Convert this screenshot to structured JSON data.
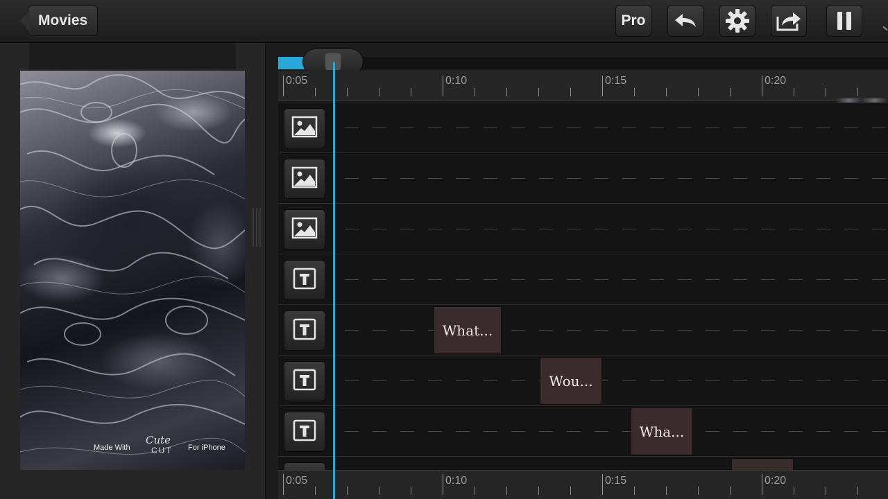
{
  "header": {
    "back_label": "Movies",
    "pro_label": "Pro",
    "icons": [
      "undo-icon",
      "gear-icon",
      "share-icon",
      "pause-icon"
    ]
  },
  "preview": {
    "watermark_left": "Made With",
    "watermark_logo_script": "Cute",
    "watermark_logo_word": "CUT",
    "watermark_right": "For iPhone"
  },
  "timeline": {
    "scrub_progress": 0.05,
    "ruler_labels": [
      "0:05",
      "0:10",
      "0:15",
      "0:20"
    ],
    "tracks": [
      {
        "type": "image",
        "icon": "image-icon"
      },
      {
        "type": "image",
        "icon": "image-icon"
      },
      {
        "type": "image",
        "icon": "image-icon"
      },
      {
        "type": "text",
        "icon": "text-icon"
      },
      {
        "type": "text",
        "icon": "text-icon",
        "clip": "What..."
      },
      {
        "type": "text",
        "icon": "text-icon",
        "clip": "Wou..."
      },
      {
        "type": "text",
        "icon": "text-icon",
        "clip": "Wha..."
      },
      {
        "type": "text",
        "icon": "text-icon"
      }
    ]
  },
  "colors": {
    "accent": "#2aa7d9",
    "clip": "#3a2b2d",
    "background": "#1d1d1d"
  }
}
